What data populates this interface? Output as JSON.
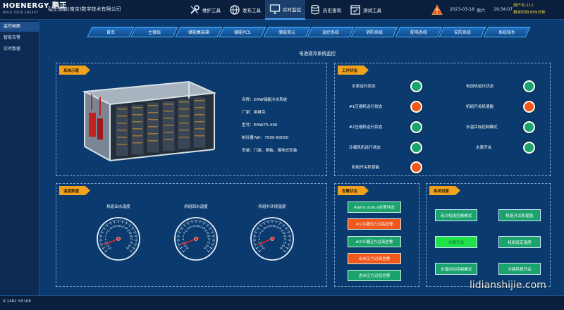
{
  "header": {
    "logo_brand": "HOENERGY 鹏正",
    "logo_slogan": "WALK YOUR ENERGY",
    "company": "弘正储能(南京)数字技术有限公司",
    "tools": [
      {
        "label": "维护工具",
        "icon": "wrench-screwdriver-icon",
        "active": false
      },
      {
        "label": "发布工具",
        "icon": "globe-publish-icon",
        "active": false
      },
      {
        "label": "实时监控",
        "icon": "monitor-icon",
        "active": true
      },
      {
        "label": "历史查询",
        "icon": "database-icon",
        "active": false
      },
      {
        "label": "测试工具",
        "icon": "test-window-icon",
        "active": false
      }
    ],
    "date": "2023-03-18",
    "weekday": "周六",
    "time": "19:34:07",
    "user_line1": "用户名:111",
    "user_line2": "剩余时间:809分钟"
  },
  "sidebar": {
    "items": [
      {
        "label": "监控画面",
        "active": true
      },
      {
        "label": "智能告警",
        "active": false
      },
      {
        "label": "实时数据",
        "active": false
      }
    ]
  },
  "nav_tabs": [
    "首页",
    "主接线",
    "储能集装箱",
    "储能PCS",
    "储能单元",
    "温控系统",
    "消防系统",
    "配电系统",
    "安防系统",
    "系统拓扑"
  ],
  "page_title": "电池液冷系统监控",
  "system_panel": {
    "tag": "系统示意",
    "info": [
      "名称：EMW储能冷水系统",
      "厂家：英维克",
      "型号：EMW75-400",
      "制冷量(W)：7500-60000",
      "安装：门装、侧装、落地式安装"
    ]
  },
  "status_panel": {
    "tag": "工作状态",
    "items": [
      {
        "label": "水泵运行状态",
        "state": "green"
      },
      {
        "label": "电加热运行状态",
        "state": "green"
      },
      {
        "label": "#1压缩机运行状态",
        "state": "orange"
      },
      {
        "label": "机组开关机使能",
        "state": "orange"
      },
      {
        "label": "#2压缩机运行状态",
        "state": "green"
      },
      {
        "label": "水温目标控制模式",
        "state": "green"
      },
      {
        "label": "冷凝风机运行状态",
        "state": "green"
      },
      {
        "label": "水泵开关",
        "state": "green"
      },
      {
        "label": "机组开关机使能",
        "state": "orange"
      }
    ]
  },
  "temp_panel": {
    "tag": "温度数据",
    "gauges": [
      {
        "title": "机组出水温度",
        "value": -20
      },
      {
        "title": "机组回水温度",
        "value": -20
      },
      {
        "title": "机组外环境温度",
        "value": -20
      }
    ],
    "scale_min": -30,
    "scale_max": 90,
    "ticks": [
      "-30",
      "-20",
      "-12",
      "-6",
      "0",
      "6",
      "12",
      "18",
      "24",
      "30",
      "36",
      "42",
      "48",
      "54",
      "60",
      "66",
      "72",
      "78",
      "84",
      "90"
    ]
  },
  "alarm_panel": {
    "tag": "告警状态",
    "items": [
      {
        "label": "Alarm status告警状态",
        "state": "green"
      },
      {
        "label": "#1冷凝压力过高告警",
        "state": "orange"
      },
      {
        "label": "#2冷凝压力过高告警",
        "state": "green"
      },
      {
        "label": "出水压力过高告警",
        "state": "orange"
      },
      {
        "label": "进水压力过低告警",
        "state": "green"
      }
    ]
  },
  "settings_panel": {
    "tag": "系统设置",
    "buttons": [
      {
        "label": "液冷机组控制模式",
        "bright": false
      },
      {
        "label": "机组开关机使能",
        "bright": false
      },
      {
        "label": "水泵开关",
        "bright": true
      },
      {
        "label": "机组设定温度",
        "bright": false
      },
      {
        "label": "水温目标控制模式",
        "bright": false
      },
      {
        "label": "冷凝风机开关",
        "bright": false
      }
    ]
  },
  "statusbar": {
    "coords": "X:1482  Y:0168"
  },
  "watermark": "lidianshijie.com",
  "colors": {
    "ok": "#1aa36d",
    "alarm": "#f2571b",
    "tag": "#f0a21c",
    "background": "#0b3b6e"
  }
}
